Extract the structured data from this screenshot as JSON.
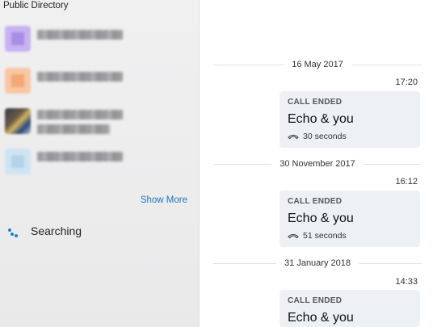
{
  "sidebar": {
    "title": "Public Directory",
    "show_more": "Show More",
    "searching": "Searching",
    "contacts": [
      {
        "avatar_color": "#c7b3f2"
      },
      {
        "avatar_color": "#f8c7a4"
      },
      {
        "avatar_color": "photo"
      },
      {
        "avatar_color": "#cfe4f2"
      }
    ]
  },
  "chat": {
    "entries": [
      {
        "date": "16 May 2017",
        "time": "17:20",
        "status": "CALL ENDED",
        "title": "Echo & you",
        "duration": "30 seconds"
      },
      {
        "date": "30 November 2017",
        "time": "16:12",
        "status": "CALL ENDED",
        "title": "Echo & you",
        "duration": "51 seconds"
      },
      {
        "date": "31 January 2018",
        "time": "14:33",
        "status": "CALL ENDED",
        "title": "Echo & you"
      }
    ]
  },
  "colors": {
    "link": "#1b75bb",
    "spinner": "#1584d8",
    "card_bg": "#edf0f4",
    "divider": "#d6e5f2"
  }
}
